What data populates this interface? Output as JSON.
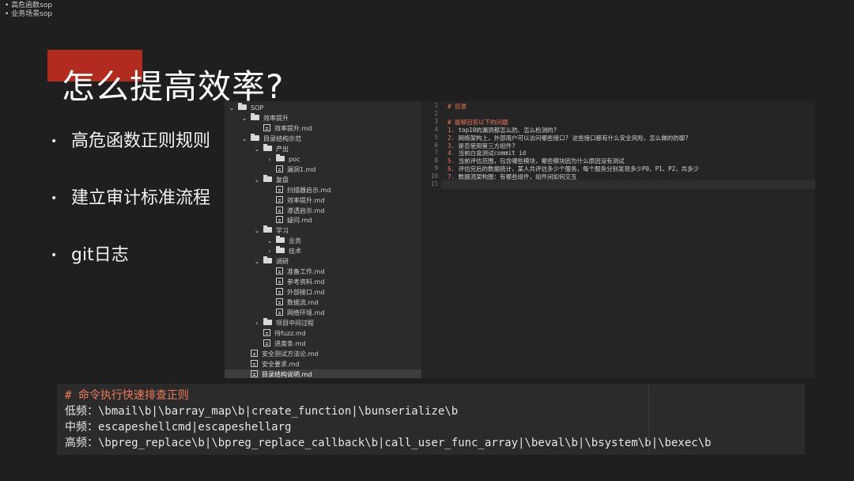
{
  "notes": [
    "高危函数sop",
    "业务场景sop"
  ],
  "title": "怎么提高效率?",
  "bullets": [
    "高危函数正则规则",
    "建立审计标准流程",
    "git日志"
  ],
  "accent_color": "#b22b1f",
  "tree": [
    {
      "label": "SOP",
      "type": "folder",
      "arrow": "⌄",
      "depth": 0
    },
    {
      "label": "效率提升",
      "type": "folder",
      "arrow": "⌄",
      "depth": 1
    },
    {
      "label": "效率提升.md",
      "type": "file",
      "arrow": "",
      "depth": 2
    },
    {
      "label": "目录结构示范",
      "type": "folder",
      "arrow": "⌄",
      "depth": 1
    },
    {
      "label": "产出",
      "type": "folder",
      "arrow": "⌄",
      "depth": 2
    },
    {
      "label": "poc",
      "type": "folder",
      "arrow": "›",
      "depth": 3
    },
    {
      "label": "漏洞1.md",
      "type": "file",
      "arrow": "",
      "depth": 3
    },
    {
      "label": "复盘",
      "type": "folder",
      "arrow": "⌄",
      "depth": 2
    },
    {
      "label": "扫描器启示.md",
      "type": "file",
      "arrow": "",
      "depth": 3
    },
    {
      "label": "效率提升.md",
      "type": "file",
      "arrow": "",
      "depth": 3
    },
    {
      "label": "渗透启示.md",
      "type": "file",
      "arrow": "",
      "depth": 3
    },
    {
      "label": "疑问.md",
      "type": "file",
      "arrow": "",
      "depth": 3
    },
    {
      "label": "学习",
      "type": "folder",
      "arrow": "⌄",
      "depth": 2
    },
    {
      "label": "业务",
      "type": "folder",
      "arrow": "⌄",
      "depth": 3
    },
    {
      "label": "技术",
      "type": "folder",
      "arrow": "›",
      "depth": 3
    },
    {
      "label": "调研",
      "type": "folder",
      "arrow": "⌄",
      "depth": 2
    },
    {
      "label": "准备工作.md",
      "type": "file",
      "arrow": "",
      "depth": 3
    },
    {
      "label": "参考资料.md",
      "type": "file",
      "arrow": "",
      "depth": 3
    },
    {
      "label": "外部接口.md",
      "type": "file",
      "arrow": "",
      "depth": 3
    },
    {
      "label": "数据流.md",
      "type": "file",
      "arrow": "",
      "depth": 3
    },
    {
      "label": "网络环境.md",
      "type": "file",
      "arrow": "",
      "depth": 3
    },
    {
      "label": "项目中间过程",
      "type": "folder",
      "arrow": "›",
      "depth": 2
    },
    {
      "label": "待fuzz.md",
      "type": "file",
      "arrow": "",
      "depth": 2
    },
    {
      "label": "进度条.md",
      "type": "file",
      "arrow": "",
      "depth": 2
    },
    {
      "label": "安全测试方法论.md",
      "type": "file",
      "arrow": "",
      "depth": 1
    },
    {
      "label": "安全要求.md",
      "type": "file",
      "arrow": "",
      "depth": 1
    },
    {
      "label": "目录结构说明.md",
      "type": "file",
      "arrow": "",
      "depth": 1,
      "selected": true
    }
  ],
  "editor": {
    "line_numbers": [
      "1",
      "2",
      "3",
      "4",
      "5",
      "6",
      "7",
      "8",
      "9",
      "10",
      "11"
    ],
    "lines": [
      {
        "num": "",
        "text": "# 目录",
        "heading": true
      },
      {
        "num": "",
        "text": "",
        "heading": false
      },
      {
        "num": "",
        "text": "# 能够回答以下的问题",
        "heading": true
      },
      {
        "num": "1.",
        "text": " top10的漏洞都怎么防、怎么检测的?",
        "heading": false
      },
      {
        "num": "2.",
        "text": " 网络架构上，外部用户可以访问哪些接口? 这些接口都有什么安全风险，怎么做的防御?",
        "heading": false
      },
      {
        "num": "3.",
        "text": " 是否使用第三方组件?",
        "heading": false
      },
      {
        "num": "4.",
        "text": " 当前白盒测试commit id",
        "heading": false
      },
      {
        "num": "5.",
        "text": " 当前评估范围，包含哪些模块，哪些模块因为什么原因没有测试",
        "heading": false
      },
      {
        "num": "6.",
        "text": " 评估完后的数据统计，某人共评估多少个服务，每个服务分别发现多少P0、P1、P2，共多少",
        "heading": false
      },
      {
        "num": "7.",
        "text": " 数据流架构图：有哪些组件，组件间如何交互",
        "heading": false
      },
      {
        "num": "",
        "text": "",
        "heading": false
      }
    ]
  },
  "codeblock": {
    "heading": "# 命令执行快速排查正则",
    "low": "低频：\\bmail\\b|\\barray_map\\b|create_function|\\bunserialize\\b",
    "mid": "中频：escapeshellcmd|escapeshellarg",
    "high": "高频：\\bpreg_replace\\b|\\bpreg_replace_callback\\b|call_user_func_array|\\beval\\b|\\bsystem\\b|\\bexec\\b"
  }
}
